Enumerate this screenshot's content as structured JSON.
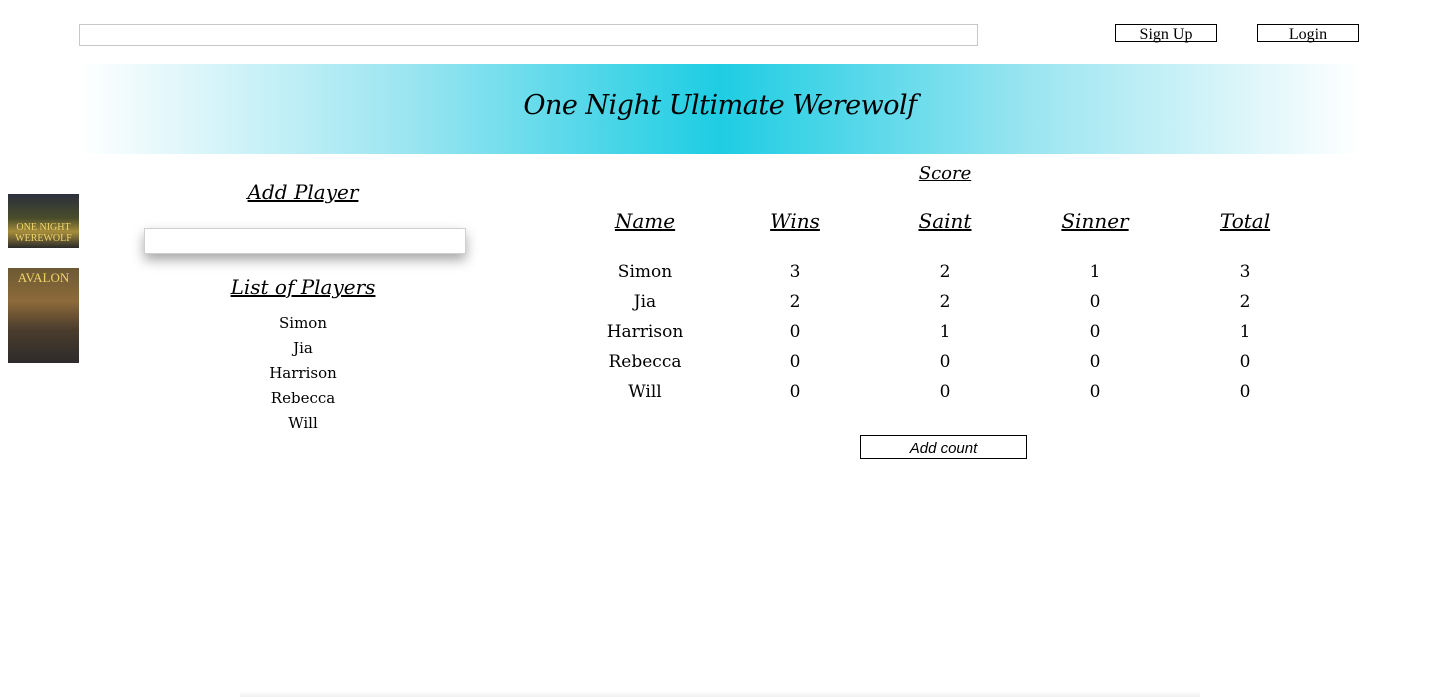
{
  "header": {
    "search_value": "",
    "signup_label": "Sign Up",
    "login_label": "Login"
  },
  "banner": {
    "title": "One Night Ultimate Werewolf"
  },
  "thumbnails": {
    "game1_label": "ONE NIGHT WEREWOLF",
    "game2_label": "AVALON"
  },
  "add_player": {
    "heading": "Add Player",
    "input_value": ""
  },
  "players": {
    "heading": "List of Players",
    "items": [
      "Simon",
      "Jia",
      "Harrison",
      "Rebecca",
      "Will"
    ]
  },
  "score": {
    "heading": "Score",
    "columns": [
      "Name",
      "Wins",
      "Saint",
      "Sinner",
      "Total"
    ],
    "rows": [
      [
        "Simon",
        "3",
        "2",
        "1",
        "3"
      ],
      [
        "Jia",
        "2",
        "2",
        "0",
        "2"
      ],
      [
        "Harrison",
        "0",
        "1",
        "0",
        "1"
      ],
      [
        "Rebecca",
        "0",
        "0",
        "0",
        "0"
      ],
      [
        "Will",
        "0",
        "0",
        "0",
        "0"
      ]
    ],
    "add_count_label": "Add count"
  },
  "colors": {
    "banner_accent": "#1ecde3"
  }
}
